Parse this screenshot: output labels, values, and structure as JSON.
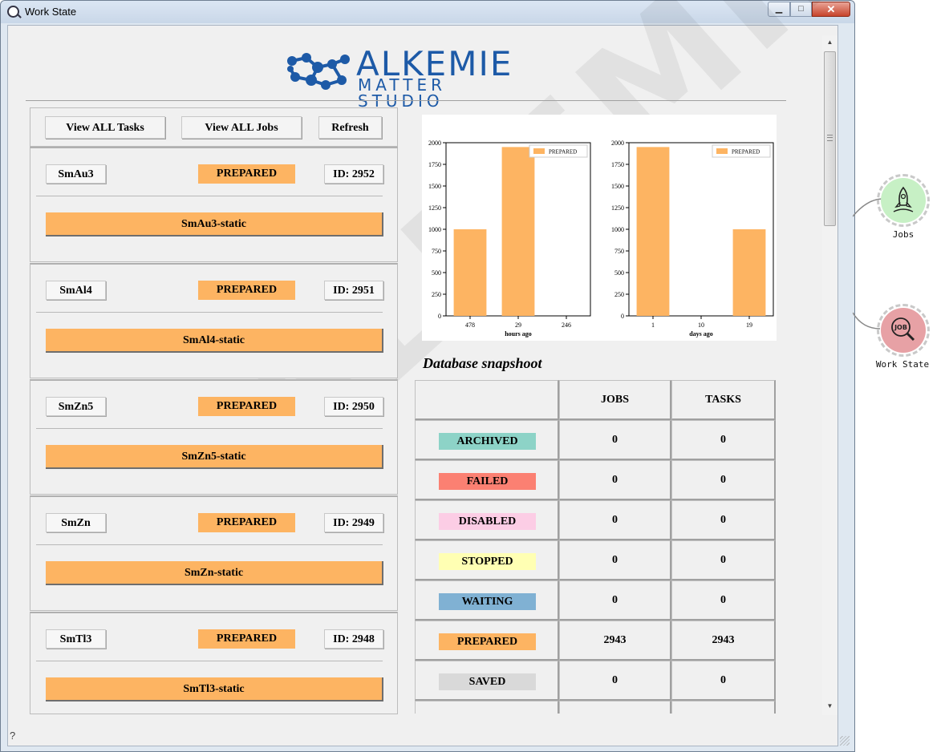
{
  "window": {
    "title": "Work State",
    "min_glyph": "▁",
    "max_glyph": "□",
    "close_glyph": "✕",
    "help_glyph": "?"
  },
  "logo": {
    "line1": "ALKEMIE",
    "line2": "MATTER STUDIO",
    "color": "#1d5aa7"
  },
  "watermark": "ALKEMIE",
  "toolbar": {
    "view_all_tasks": "View ALL Tasks",
    "view_all_jobs": "View ALL Jobs",
    "refresh": "Refresh"
  },
  "tasks": [
    {
      "name": "SmAu3",
      "status": "PREPARED",
      "id_label": "ID: 2952",
      "job": "SmAu3-static"
    },
    {
      "name": "SmAl4",
      "status": "PREPARED",
      "id_label": "ID: 2951",
      "job": "SmAl4-static"
    },
    {
      "name": "SmZn5",
      "status": "PREPARED",
      "id_label": "ID: 2950",
      "job": "SmZn5-static"
    },
    {
      "name": "SmZn",
      "status": "PREPARED",
      "id_label": "ID: 2949",
      "job": "SmZn-static"
    },
    {
      "name": "SmTl3",
      "status": "PREPARED",
      "id_label": "ID: 2948",
      "job": "SmTl3-static"
    }
  ],
  "chart_data": [
    {
      "type": "bar",
      "categories": [
        "478",
        "29",
        "246"
      ],
      "series": [
        {
          "name": "PREPARED",
          "values": [
            1000,
            1950,
            0
          ]
        }
      ],
      "xlabel": "hours ago",
      "ylabel": "",
      "ylim": [
        0,
        2000
      ],
      "yticks": [
        0,
        250,
        500,
        750,
        1000,
        1250,
        1500,
        1750,
        2000
      ],
      "legend": "top-right",
      "color": "#fdb462"
    },
    {
      "type": "bar",
      "categories": [
        "1",
        "10",
        "19"
      ],
      "series": [
        {
          "name": "PREPARED",
          "values": [
            1950,
            0,
            1000
          ]
        }
      ],
      "xlabel": "days ago",
      "ylabel": "",
      "ylim": [
        0,
        2000
      ],
      "yticks": [
        0,
        250,
        500,
        750,
        1000,
        1250,
        1500,
        1750,
        2000
      ],
      "legend": "top-right",
      "color": "#fdb462"
    }
  ],
  "snapshot": {
    "title": "Database snapshoot",
    "headers": [
      "",
      "JOBS",
      "TASKS"
    ],
    "rows": [
      {
        "status": "ARCHIVED",
        "color": "#8dd3c7",
        "jobs": "0",
        "tasks": "0"
      },
      {
        "status": "FAILED",
        "color": "#fb8072",
        "jobs": "0",
        "tasks": "0"
      },
      {
        "status": "DISABLED",
        "color": "#fccde5",
        "jobs": "0",
        "tasks": "0"
      },
      {
        "status": "STOPPED",
        "color": "#ffffb3",
        "jobs": "0",
        "tasks": "0"
      },
      {
        "status": "WAITING",
        "color": "#80b1d3",
        "jobs": "0",
        "tasks": "0"
      },
      {
        "status": "PREPARED",
        "color": "#fdb462",
        "jobs": "2943",
        "tasks": "2943"
      },
      {
        "status": "SAVED",
        "color": "#d9d9d9",
        "jobs": "0",
        "tasks": "0"
      },
      {
        "status": "",
        "color": "#bebada",
        "jobs": "",
        "tasks": ""
      }
    ]
  },
  "nodes": [
    {
      "label": "Jobs",
      "color": "#c7f0c5",
      "icon_text": ""
    },
    {
      "label": "Work State",
      "color": "#e7a1a5",
      "icon_text": "JOB"
    }
  ]
}
